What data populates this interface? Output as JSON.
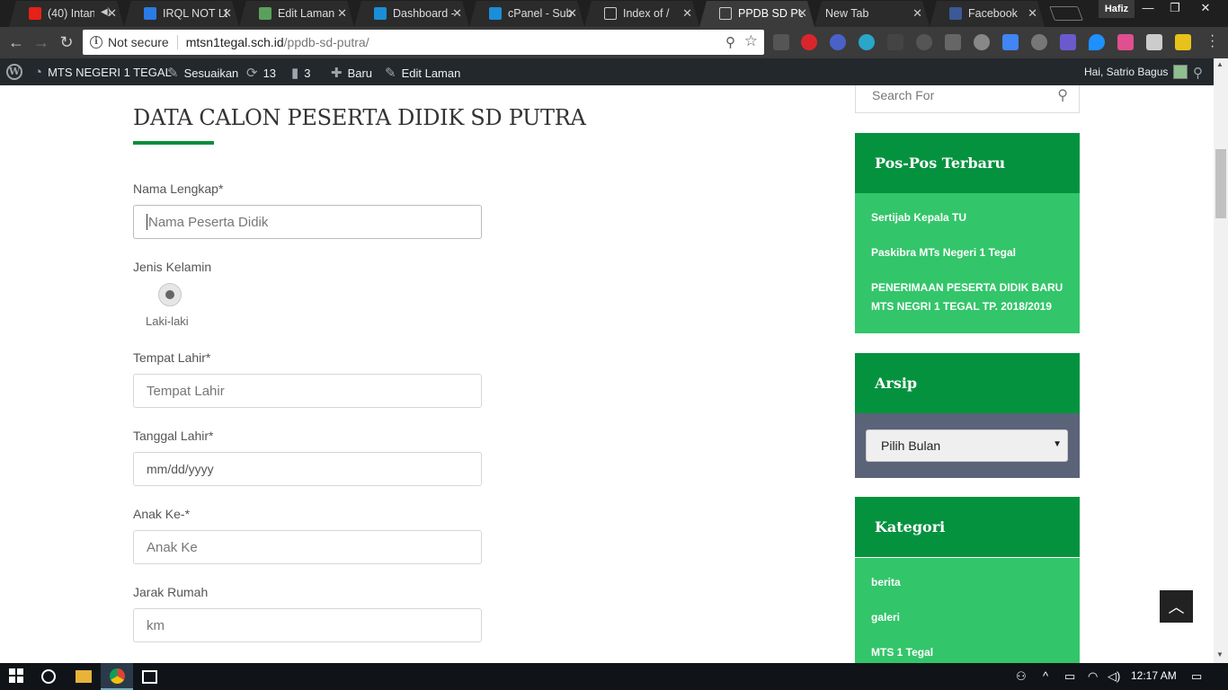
{
  "browser": {
    "tabs": [
      {
        "title": "(40) Intan",
        "favicon_color": "#e62117",
        "audio": true
      },
      {
        "title": "IRQL NOT LE",
        "favicon_color": "#2a7be4"
      },
      {
        "title": "Edit Laman",
        "favicon_color": "#5aa05a"
      },
      {
        "title": "Dashboard -",
        "favicon_color": "#1a8ed8"
      },
      {
        "title": "cPanel - Sub",
        "favicon_color": "#1a8ed8"
      },
      {
        "title": "Index of /",
        "favicon_color": "#cccccc"
      },
      {
        "title": "PPDB SD PU",
        "favicon_color": "#cccccc",
        "active": true
      },
      {
        "title": "New Tab",
        "favicon_color": ""
      },
      {
        "title": "Facebook",
        "favicon_color": "#3b5998"
      }
    ],
    "profile_name": "Hafiz",
    "security_label": "Not secure",
    "url_host": "mtsn1tegal.sch.id",
    "url_path": "/ppdb-sd-putra/"
  },
  "adminbar": {
    "site_name": "MTS NEGERI 1 TEGAL",
    "customize": "Sesuaikan",
    "updates_count": "13",
    "comments_count": "3",
    "new_label": "Baru",
    "edit_label": "Edit Laman",
    "greeting": "Hai, Satrio Bagus"
  },
  "form": {
    "title": "DATA CALON PESERTA DIDIK SD PUTRA",
    "fields": [
      {
        "label": "Nama Lengkap*",
        "placeholder": "Nama Peserta Didik"
      },
      {
        "label": "Jenis Kelamin",
        "option": "Laki-laki"
      },
      {
        "label": "Tempat Lahir*",
        "placeholder": "Tempat Lahir"
      },
      {
        "label": "Tanggal Lahir*",
        "placeholder": "mm/dd/yyyy"
      },
      {
        "label": "Anak Ke-*",
        "placeholder": "Anak Ke"
      },
      {
        "label": "Jarak Rumah",
        "placeholder": "km"
      }
    ]
  },
  "sidebar": {
    "search_placeholder": "Search For",
    "recent": {
      "title": "Pos-Pos Terbaru",
      "items": [
        "Sertijab Kepala TU",
        "Paskibra MTs Negeri 1 Tegal",
        "PENERIMAAN PESERTA DIDIK BARU MTS NEGRI 1 TEGAL TP. 2018/2019"
      ]
    },
    "archive": {
      "title": "Arsip",
      "select_value": "Pilih Bulan"
    },
    "categories": {
      "title": "Kategori",
      "items": [
        "berita",
        "galeri",
        "MTS 1 Tegal"
      ]
    }
  },
  "taskbar": {
    "time": "12:17 AM"
  },
  "colors": {
    "green_dark": "#05923f",
    "green_light": "#33c56a",
    "archive_bg": "#5b6379"
  }
}
